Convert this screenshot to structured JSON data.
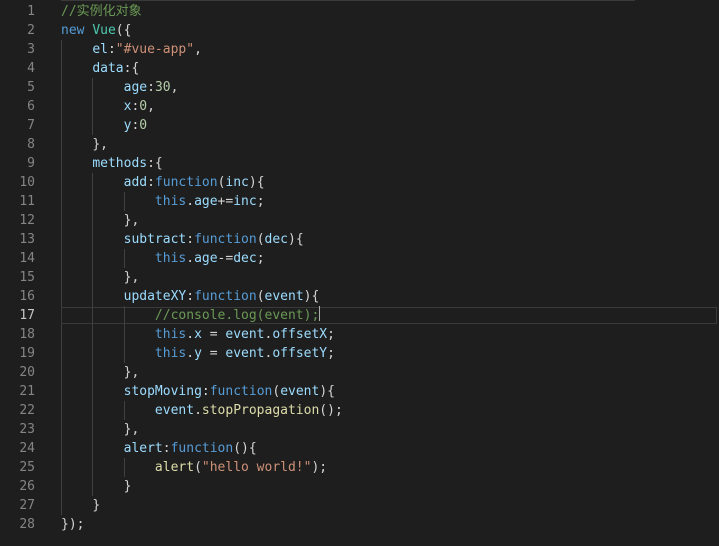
{
  "editor": {
    "current_line": 17,
    "lines": [
      {
        "n": "1",
        "tokens": [
          [
            "comment",
            "//实例化对象"
          ]
        ]
      },
      {
        "n": "2",
        "tokens": [
          [
            "keyword",
            "new"
          ],
          [
            "plain",
            " "
          ],
          [
            "class",
            "Vue"
          ],
          [
            "punct",
            "({"
          ]
        ]
      },
      {
        "n": "3",
        "tokens": [
          [
            "plain",
            "    "
          ],
          [
            "prop",
            "el"
          ],
          [
            "punct",
            ":"
          ],
          [
            "string",
            "\"#vue-app\""
          ],
          [
            "punct",
            ","
          ]
        ]
      },
      {
        "n": "4",
        "tokens": [
          [
            "plain",
            "    "
          ],
          [
            "prop",
            "data"
          ],
          [
            "punct",
            ":{"
          ]
        ]
      },
      {
        "n": "5",
        "tokens": [
          [
            "plain",
            "        "
          ],
          [
            "prop",
            "age"
          ],
          [
            "punct",
            ":"
          ],
          [
            "number",
            "30"
          ],
          [
            "punct",
            ","
          ]
        ]
      },
      {
        "n": "6",
        "tokens": [
          [
            "plain",
            "        "
          ],
          [
            "prop",
            "x"
          ],
          [
            "punct",
            ":"
          ],
          [
            "number",
            "0"
          ],
          [
            "punct",
            ","
          ]
        ]
      },
      {
        "n": "7",
        "tokens": [
          [
            "plain",
            "        "
          ],
          [
            "prop",
            "y"
          ],
          [
            "punct",
            ":"
          ],
          [
            "number",
            "0"
          ]
        ]
      },
      {
        "n": "8",
        "tokens": [
          [
            "plain",
            "    "
          ],
          [
            "punct",
            "},"
          ]
        ]
      },
      {
        "n": "9",
        "tokens": [
          [
            "plain",
            "    "
          ],
          [
            "prop",
            "methods"
          ],
          [
            "punct",
            ":{"
          ]
        ]
      },
      {
        "n": "10",
        "tokens": [
          [
            "plain",
            "        "
          ],
          [
            "prop",
            "add"
          ],
          [
            "punct",
            ":"
          ],
          [
            "keyword",
            "function"
          ],
          [
            "punct",
            "("
          ],
          [
            "prop",
            "inc"
          ],
          [
            "punct",
            "){"
          ]
        ]
      },
      {
        "n": "11",
        "tokens": [
          [
            "plain",
            "            "
          ],
          [
            "keyword",
            "this"
          ],
          [
            "punct",
            "."
          ],
          [
            "prop",
            "age"
          ],
          [
            "punct",
            "+="
          ],
          [
            "prop",
            "inc"
          ],
          [
            "punct",
            ";"
          ]
        ]
      },
      {
        "n": "12",
        "tokens": [
          [
            "plain",
            "        "
          ],
          [
            "punct",
            "},"
          ]
        ]
      },
      {
        "n": "13",
        "tokens": [
          [
            "plain",
            "        "
          ],
          [
            "prop",
            "subtract"
          ],
          [
            "punct",
            ":"
          ],
          [
            "keyword",
            "function"
          ],
          [
            "punct",
            "("
          ],
          [
            "prop",
            "dec"
          ],
          [
            "punct",
            "){"
          ]
        ]
      },
      {
        "n": "14",
        "tokens": [
          [
            "plain",
            "            "
          ],
          [
            "keyword",
            "this"
          ],
          [
            "punct",
            "."
          ],
          [
            "prop",
            "age"
          ],
          [
            "punct",
            "-="
          ],
          [
            "prop",
            "dec"
          ],
          [
            "punct",
            ";"
          ]
        ]
      },
      {
        "n": "15",
        "tokens": [
          [
            "plain",
            "        "
          ],
          [
            "punct",
            "},"
          ]
        ]
      },
      {
        "n": "16",
        "tokens": [
          [
            "plain",
            "        "
          ],
          [
            "prop",
            "updateXY"
          ],
          [
            "punct",
            ":"
          ],
          [
            "keyword",
            "function"
          ],
          [
            "punct",
            "("
          ],
          [
            "prop",
            "event"
          ],
          [
            "punct",
            "){"
          ]
        ]
      },
      {
        "n": "17",
        "tokens": [
          [
            "plain",
            "            "
          ],
          [
            "comment",
            "//console.log(event);"
          ]
        ]
      },
      {
        "n": "18",
        "tokens": [
          [
            "plain",
            "            "
          ],
          [
            "keyword",
            "this"
          ],
          [
            "punct",
            "."
          ],
          [
            "prop",
            "x"
          ],
          [
            "punct",
            " = "
          ],
          [
            "prop",
            "event"
          ],
          [
            "punct",
            "."
          ],
          [
            "prop",
            "offsetX"
          ],
          [
            "punct",
            ";"
          ]
        ]
      },
      {
        "n": "19",
        "tokens": [
          [
            "plain",
            "            "
          ],
          [
            "keyword",
            "this"
          ],
          [
            "punct",
            "."
          ],
          [
            "prop",
            "y"
          ],
          [
            "punct",
            " = "
          ],
          [
            "prop",
            "event"
          ],
          [
            "punct",
            "."
          ],
          [
            "prop",
            "offsetY"
          ],
          [
            "punct",
            ";"
          ]
        ]
      },
      {
        "n": "20",
        "tokens": [
          [
            "plain",
            "        "
          ],
          [
            "punct",
            "},"
          ]
        ]
      },
      {
        "n": "21",
        "tokens": [
          [
            "plain",
            "        "
          ],
          [
            "prop",
            "stopMoving"
          ],
          [
            "punct",
            ":"
          ],
          [
            "keyword",
            "function"
          ],
          [
            "punct",
            "("
          ],
          [
            "prop",
            "event"
          ],
          [
            "punct",
            "){"
          ]
        ]
      },
      {
        "n": "22",
        "tokens": [
          [
            "plain",
            "            "
          ],
          [
            "prop",
            "event"
          ],
          [
            "punct",
            "."
          ],
          [
            "func",
            "stopPropagation"
          ],
          [
            "punct",
            "();"
          ]
        ]
      },
      {
        "n": "23",
        "tokens": [
          [
            "plain",
            "        "
          ],
          [
            "punct",
            "},"
          ]
        ]
      },
      {
        "n": "24",
        "tokens": [
          [
            "plain",
            "        "
          ],
          [
            "prop",
            "alert"
          ],
          [
            "punct",
            ":"
          ],
          [
            "keyword",
            "function"
          ],
          [
            "punct",
            "(){"
          ]
        ]
      },
      {
        "n": "25",
        "tokens": [
          [
            "plain",
            "            "
          ],
          [
            "func",
            "alert"
          ],
          [
            "punct",
            "("
          ],
          [
            "string",
            "\"hello world!\""
          ],
          [
            "punct",
            ");"
          ]
        ]
      },
      {
        "n": "26",
        "tokens": [
          [
            "plain",
            "        "
          ],
          [
            "punct",
            "}"
          ]
        ]
      },
      {
        "n": "27",
        "tokens": [
          [
            "plain",
            "    "
          ],
          [
            "punct",
            "}"
          ]
        ]
      },
      {
        "n": "28",
        "tokens": [
          [
            "punct",
            "});"
          ]
        ]
      }
    ]
  }
}
